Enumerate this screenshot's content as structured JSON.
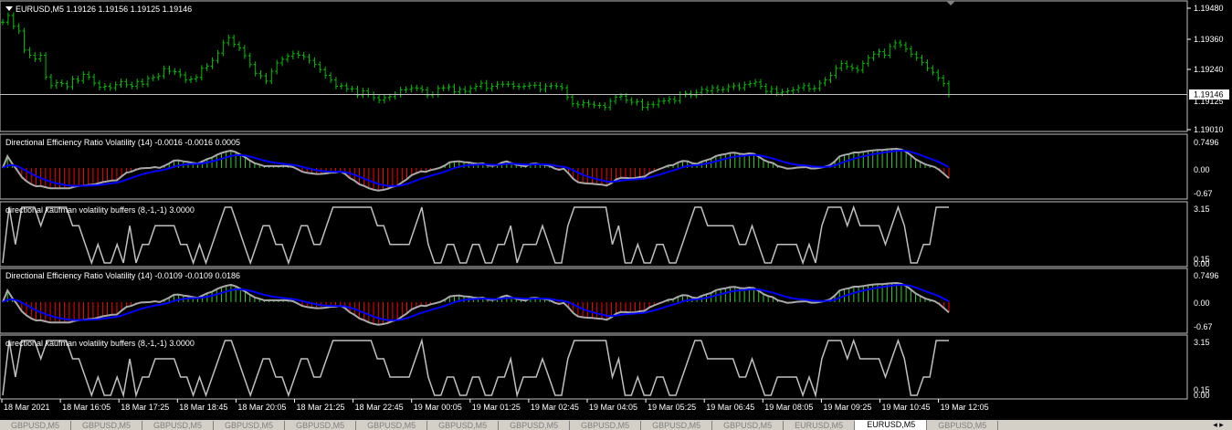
{
  "main_panel": {
    "menu_icon": "triangle-down-icon",
    "header": "EURUSD,M5  1.19126 1.19156 1.19125 1.19146",
    "price_ticks": [
      "1.19480",
      "1.19360",
      "1.19240",
      "1.19125",
      "1.19010"
    ],
    "current_price": "1.19146",
    "shift_marker_icon": "triangle-down-icon"
  },
  "indicator_panels": [
    {
      "title": "Directional Efficiency Ratio Volatility (14) -0.0016 -0.0016 0.0005",
      "ticks": [
        "0.7496",
        "0.00",
        "-0.67"
      ]
    },
    {
      "title": "directional kaufman volatility buffers (8,-1,-1) 3.0000",
      "ticks": [
        "3.15",
        "0.15",
        "0.00"
      ]
    },
    {
      "title": "Directional Efficiency Ratio Volatility (14) -0.0109 -0.0109 0.0186",
      "ticks": [
        "0.7496",
        "0.00",
        "-0.67"
      ]
    },
    {
      "title": "directional kaufman volatility buffers (8,-1,-1) 3.0000",
      "ticks": [
        "3.15",
        "0.15",
        "0.00"
      ]
    }
  ],
  "time_axis": [
    "18 Mar 2021",
    "18 Mar 16:05",
    "18 Mar 17:25",
    "18 Mar 18:45",
    "18 Mar 20:05",
    "18 Mar 21:25",
    "18 Mar 22:45",
    "19 Mar 00:05",
    "19 Mar 01:25",
    "19 Mar 02:45",
    "19 Mar 04:05",
    "19 Mar 05:25",
    "19 Mar 06:45",
    "19 Mar 08:05",
    "19 Mar 09:25",
    "19 Mar 10:45",
    "19 Mar 12:05"
  ],
  "tabs": [
    "GBPUSD,M5",
    "GBPUSD,M5",
    "GBPUSD,M5",
    "GBPUSD,M5",
    "GBPUSD,M5",
    "GBPUSD,M5",
    "GBPUSD,M5",
    "GBPUSD,M5",
    "GBPUSD,M5",
    "GBPUSD,M5",
    "GBPUSD,M5",
    "EURUSD,M5",
    "EURUSD,M5",
    "GBPUSD,M5"
  ],
  "active_tab_index": 12,
  "colors": {
    "background": "#000000",
    "grid": "#c0c0c0",
    "candles": "#00c000",
    "bull_hist": "#32cd32",
    "bear_hist": "#ff0000",
    "signal_line": "#0000ff",
    "er_line": "#a9a9a9",
    "buffer_line": "#c0c0c0",
    "text": "#ffffff"
  },
  "chart_data": {
    "type": "line",
    "symbol": "EURUSD",
    "timeframe": "M5",
    "ylim": [
      1.1901,
      1.1948
    ],
    "close": [
      1.19426,
      1.19452,
      1.1941,
      1.19392,
      1.19318,
      1.19298,
      1.19284,
      1.19298,
      1.19214,
      1.1918,
      1.19192,
      1.19188,
      1.19176,
      1.19206,
      1.192,
      1.19224,
      1.19214,
      1.1919,
      1.19174,
      1.19178,
      1.19172,
      1.19184,
      1.19196,
      1.19184,
      1.19178,
      1.19196,
      1.19186,
      1.19208,
      1.19212,
      1.19218,
      1.19246,
      1.19236,
      1.19234,
      1.19222,
      1.19202,
      1.19206,
      1.19212,
      1.19248,
      1.19256,
      1.19278,
      1.19306,
      1.19346,
      1.19366,
      1.1934,
      1.19326,
      1.19296,
      1.19262,
      1.19228,
      1.19218,
      1.19198,
      1.19236,
      1.19268,
      1.19282,
      1.19294,
      1.19304,
      1.19298,
      1.19292,
      1.19278,
      1.19262,
      1.19242,
      1.1922,
      1.19202,
      1.19178,
      1.1918,
      1.19168,
      1.19168,
      1.19144,
      1.1916,
      1.19146,
      1.19134,
      1.19124,
      1.19134,
      1.19138,
      1.19146,
      1.19164,
      1.19166,
      1.19172,
      1.1917,
      1.19164,
      1.19144,
      1.19146,
      1.1917,
      1.19172,
      1.19176,
      1.19156,
      1.19166,
      1.19158,
      1.1917,
      1.19178,
      1.1919,
      1.1917,
      1.19178,
      1.19186,
      1.19186,
      1.19186,
      1.19178,
      1.19176,
      1.19178,
      1.19182,
      1.19182,
      1.19166,
      1.19178,
      1.1918,
      1.19178,
      1.19172,
      1.19136,
      1.1911,
      1.19106,
      1.19114,
      1.19108,
      1.19104,
      1.19104,
      1.19096,
      1.1912,
      1.19136,
      1.1914,
      1.19124,
      1.19116,
      1.19118,
      1.19096,
      1.19108,
      1.19106,
      1.1912,
      1.19122,
      1.19128,
      1.19122,
      1.19146,
      1.1915,
      1.19144,
      1.19154,
      1.19166,
      1.1916,
      1.19172,
      1.19164,
      1.19166,
      1.19176,
      1.1918,
      1.19172,
      1.19184,
      1.19188,
      1.19194,
      1.19178,
      1.19158,
      1.19168,
      1.19152,
      1.19156,
      1.1916,
      1.19164,
      1.19172,
      1.1918,
      1.19168,
      1.1917,
      1.1919,
      1.19202,
      1.1922,
      1.19248,
      1.19266,
      1.19254,
      1.19248,
      1.1924,
      1.19266,
      1.19288,
      1.19302,
      1.19312,
      1.19298,
      1.19332,
      1.19346,
      1.19338,
      1.19322,
      1.19302,
      1.19288,
      1.1927,
      1.19248,
      1.19232,
      1.1921,
      1.19188,
      1.19146
    ]
  }
}
